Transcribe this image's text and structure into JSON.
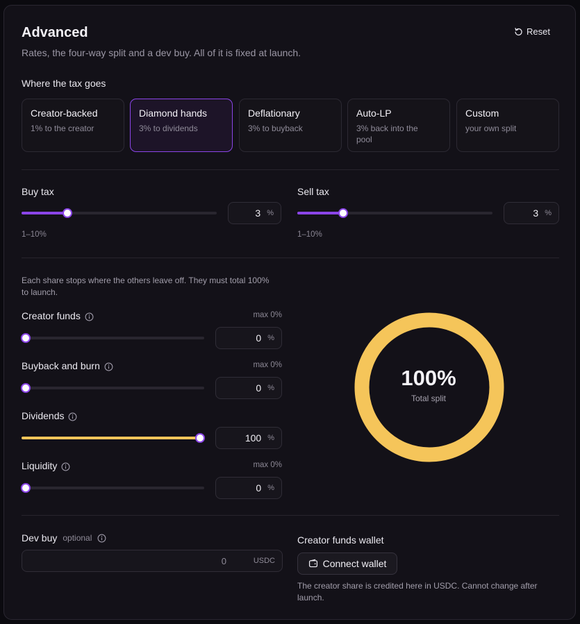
{
  "header": {
    "title": "Advanced",
    "subtitle": "Rates, the four-way split and a dev buy. All of it is fixed at launch.",
    "reset_label": "Reset"
  },
  "presets": {
    "section_label": "Where the tax goes",
    "items": [
      {
        "title": "Creator-backed",
        "desc": "1% to the creator",
        "active": false
      },
      {
        "title": "Diamond hands",
        "desc": "3% to dividends",
        "active": true
      },
      {
        "title": "Deflationary",
        "desc": "3% to buyback",
        "active": false
      },
      {
        "title": "Auto-LP",
        "desc": "3% back into the pool",
        "active": false
      },
      {
        "title": "Custom",
        "desc": "your own split",
        "active": false
      }
    ]
  },
  "tax": {
    "buy": {
      "label": "Buy tax",
      "value": "3",
      "unit": "%",
      "range": "1–10%",
      "min": 1,
      "max": 10
    },
    "sell": {
      "label": "Sell tax",
      "value": "3",
      "unit": "%",
      "range": "1–10%",
      "min": 1,
      "max": 10
    }
  },
  "split": {
    "note": "Each share stops where the others leave off. They must total 100% to launch.",
    "items": [
      {
        "label": "Creator funds",
        "value": "0",
        "unit": "%",
        "max": "max 0%"
      },
      {
        "label": "Buyback and burn",
        "value": "0",
        "unit": "%",
        "max": "max 0%"
      },
      {
        "label": "Dividends",
        "value": "100",
        "unit": "%",
        "max": ""
      },
      {
        "label": "Liquidity",
        "value": "0",
        "unit": "%",
        "max": "max 0%"
      }
    ],
    "total_pct": "100%",
    "total_label": "Total split"
  },
  "dev_buy": {
    "label": "Dev buy",
    "optional": "optional",
    "value": "0",
    "unit": "USDC"
  },
  "wallet": {
    "label": "Creator funds wallet",
    "button": "Connect wallet",
    "note": "The creator share is credited here in USDC. Cannot change after launch."
  },
  "colors": {
    "accent": "#8b45e8",
    "dividends": "#f5c55a"
  }
}
